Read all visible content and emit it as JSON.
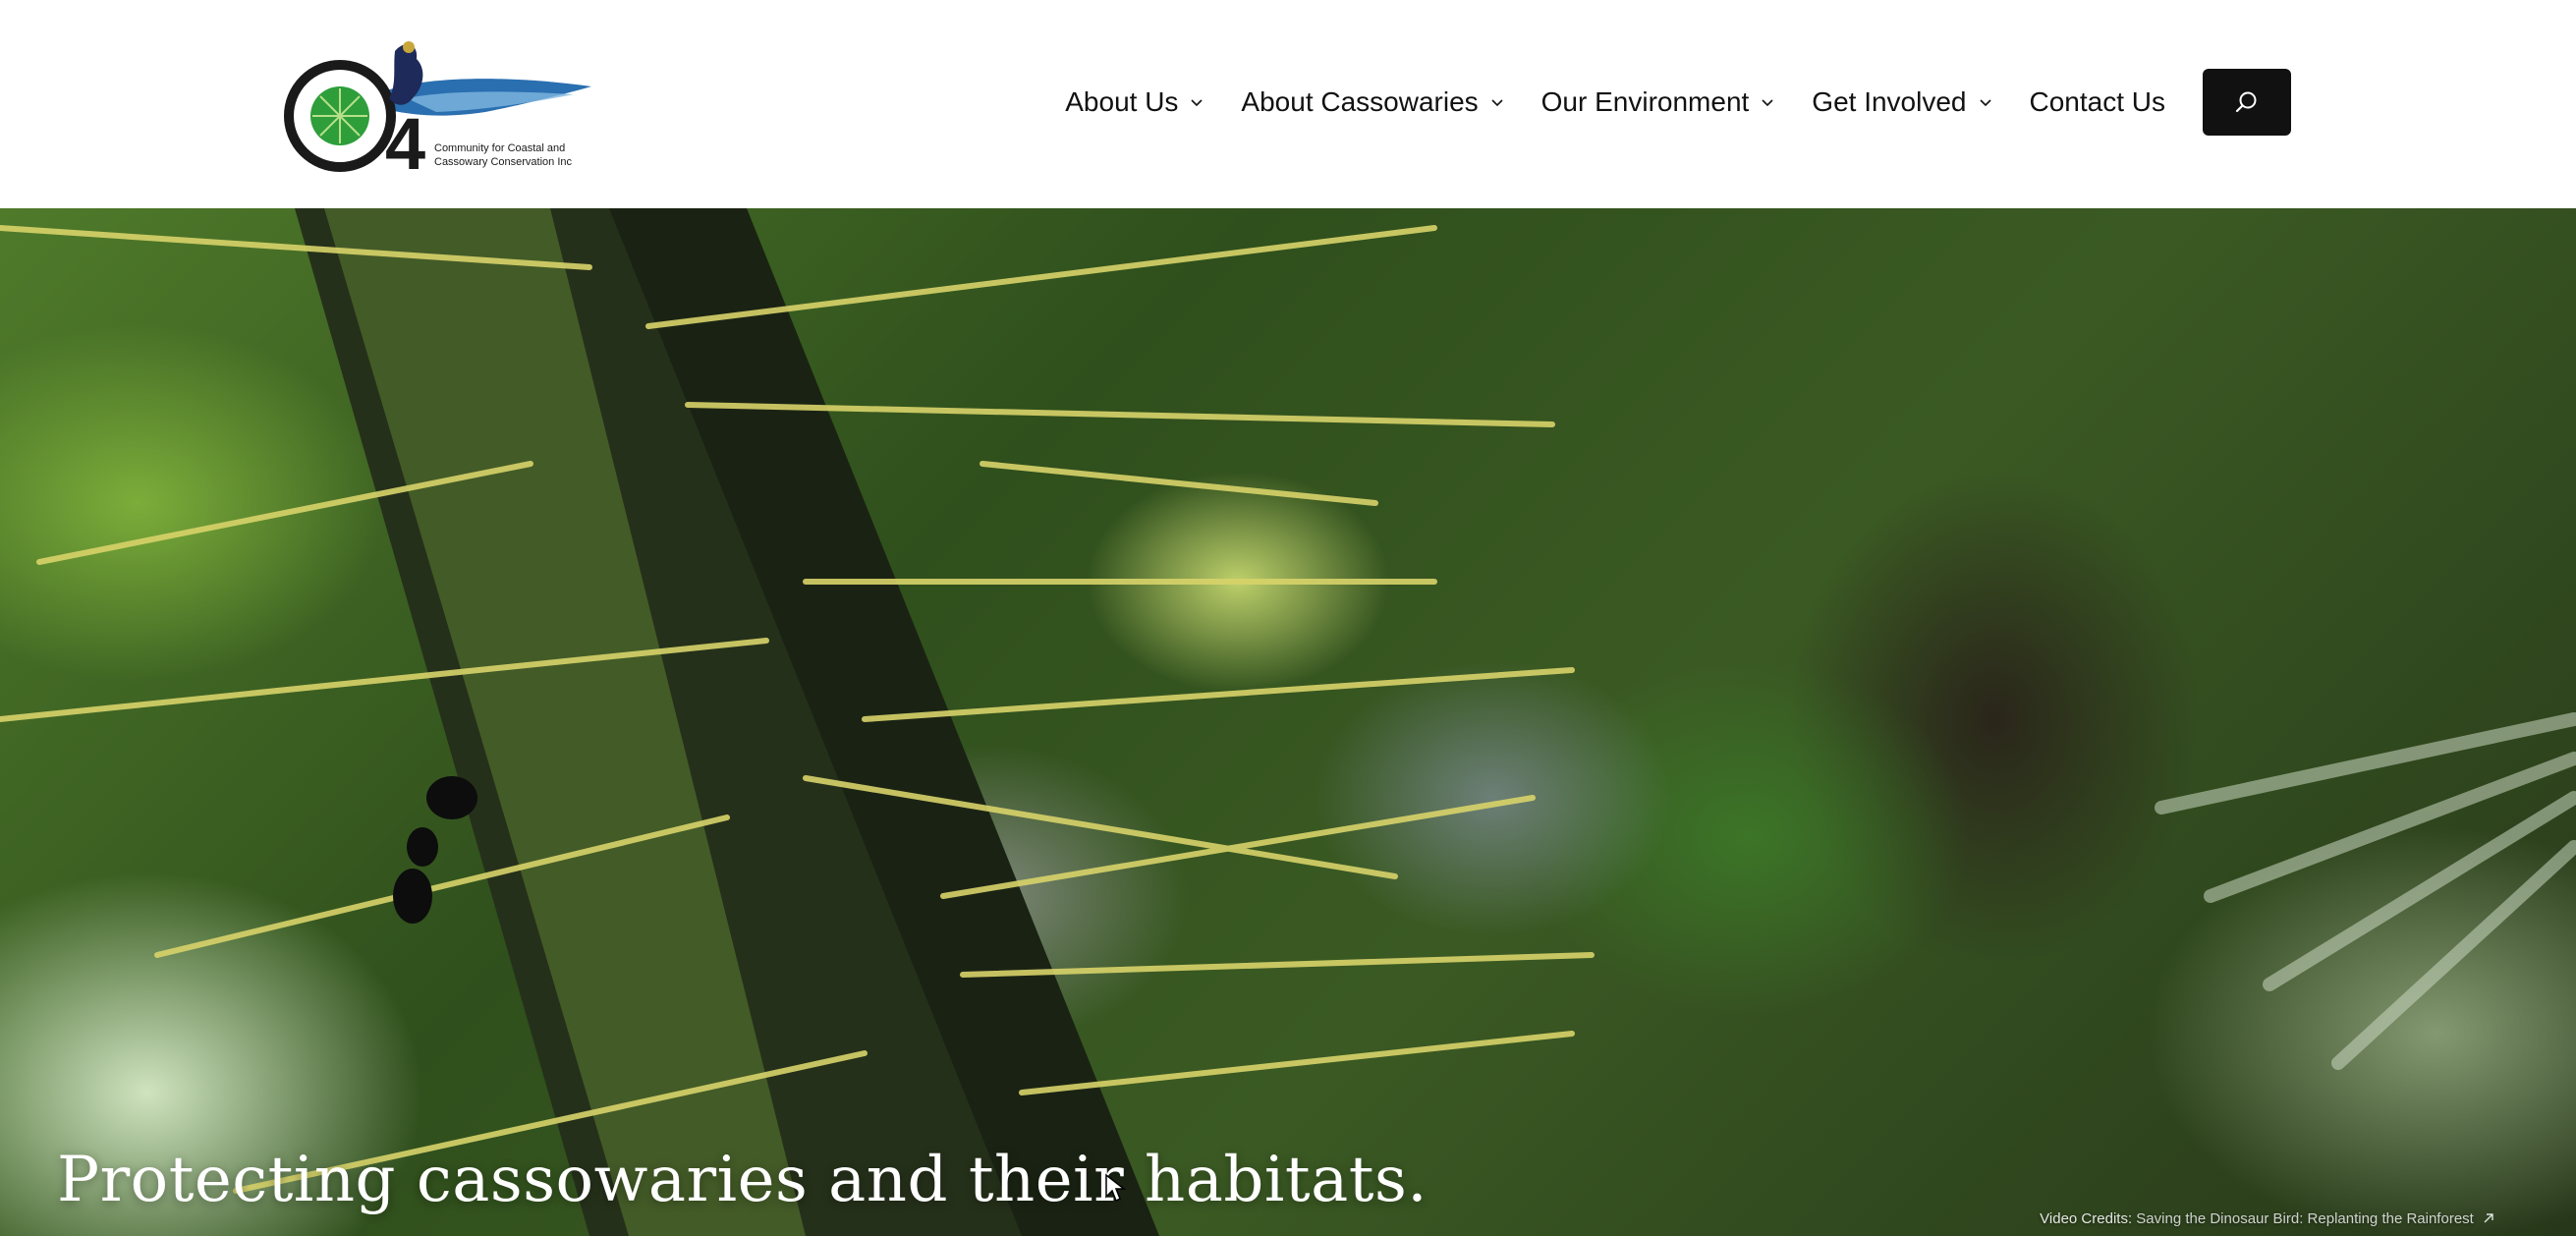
{
  "header": {
    "logo": {
      "text_line1": "Community for  Coastal and",
      "text_line2": "Cassowary Conservation Inc",
      "mark_text": "4",
      "colors": {
        "ring": "#1a1a1a",
        "leaf": "#2e9e3a",
        "water": "#2a6fb0",
        "bird": "#1e2a5a"
      }
    },
    "nav": {
      "items": [
        {
          "label": "About Us",
          "has_dropdown": true
        },
        {
          "label": "About Cassowaries",
          "has_dropdown": true
        },
        {
          "label": "Our Environment",
          "has_dropdown": true
        },
        {
          "label": "Get Involved",
          "has_dropdown": true
        },
        {
          "label": "Contact Us",
          "has_dropdown": false
        }
      ],
      "dropdown_icon": "chevron-down-icon",
      "search_icon": "search-icon"
    },
    "colors": {
      "background": "#ffffff",
      "text": "#111111",
      "search_button": "#111111"
    }
  },
  "hero": {
    "title": "Protecting cassowaries and their habitats.",
    "video_credits": {
      "label": "Video Credits:",
      "link_text": "Saving the Dinosaur Bird: Replanting the Rainforest",
      "icon": "external-link-icon"
    },
    "background": "rainforest video still: spiny palm trunk with ant"
  }
}
